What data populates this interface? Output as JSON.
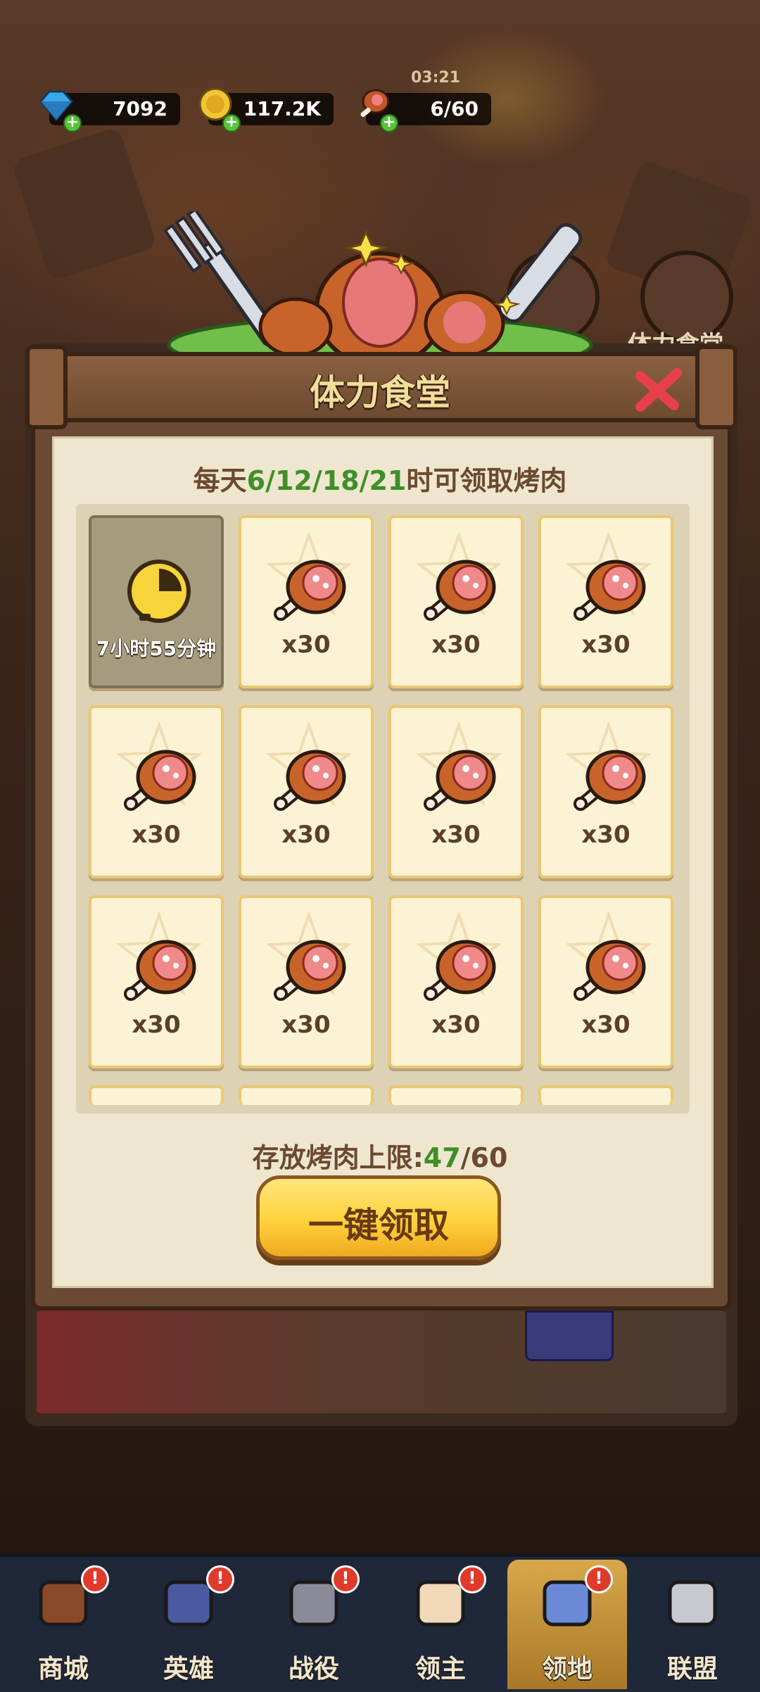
{
  "status": {
    "timer": "03:21"
  },
  "resources": {
    "gems": "7092",
    "gold": "117.2K",
    "stamina": "6/60"
  },
  "side": {
    "canteen_label": "体力食堂"
  },
  "modal": {
    "title": "体力食堂",
    "subtitle_prefix": "每天",
    "subtitle_hours": "6/12/18/21",
    "subtitle_suffix": "时可领取烤肉",
    "timer_slot": "7小时55分钟",
    "items": [
      "x30",
      "x30",
      "x30",
      "x30",
      "x30",
      "x30",
      "x30",
      "x30",
      "x30",
      "x30",
      "x30"
    ],
    "limit_label": "存放烤肉上限:",
    "limit_current": "47",
    "limit_max": "/60",
    "claim_all": "一键领取"
  },
  "nav": [
    {
      "label": "商城",
      "badge": "!"
    },
    {
      "label": "英雄",
      "badge": "!"
    },
    {
      "label": "战役",
      "badge": "!"
    },
    {
      "label": "领主",
      "badge": "!"
    },
    {
      "label": "领地",
      "badge": "!",
      "active": true
    },
    {
      "label": "联盟",
      "badge": ""
    }
  ],
  "colors": {
    "accent_green": "#3f8f28",
    "title_gold": "#f2dd9a",
    "button_yellow": "#ffd23c"
  }
}
